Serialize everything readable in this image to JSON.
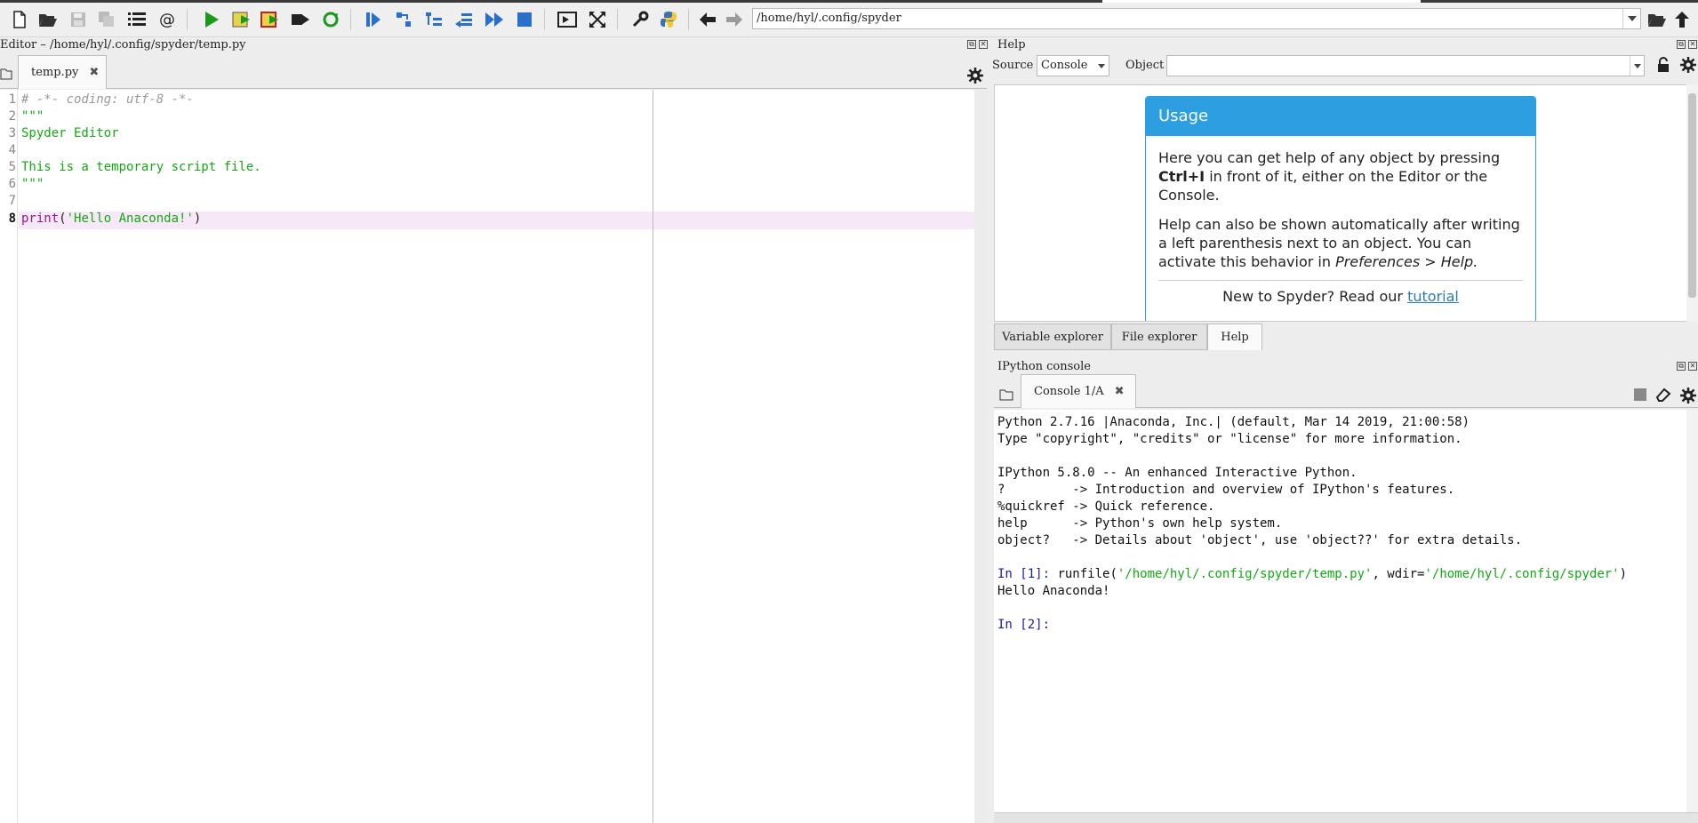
{
  "toolbar": {
    "path": "/home/hyl/.config/spyder",
    "icons": [
      "new-file",
      "open-file",
      "save-file",
      "save-all",
      "outline",
      "at-sign",
      "run",
      "run-cell",
      "run-cell-advance",
      "run-selection",
      "rerun",
      "debug",
      "step",
      "step-into",
      "step-return",
      "continue",
      "stop",
      "maximize-pane",
      "fullscreen",
      "preferences",
      "python-path",
      "back",
      "forward",
      "browse",
      "parent-dir"
    ]
  },
  "editor": {
    "title": "Editor – /home/hyl/.config/spyder/temp.py",
    "tab": "temp.py",
    "lines": [
      {
        "n": "1",
        "text": "# -*- coding: utf-8 -*-",
        "kind": "comment"
      },
      {
        "n": "2",
        "text": "\"\"\"",
        "kind": "string"
      },
      {
        "n": "3",
        "text": "Spyder Editor",
        "kind": "string"
      },
      {
        "n": "4",
        "text": "",
        "kind": "string"
      },
      {
        "n": "5",
        "text": "This is a temporary script file.",
        "kind": "string"
      },
      {
        "n": "6",
        "text": "\"\"\"",
        "kind": "string"
      },
      {
        "n": "7",
        "text": "",
        "kind": "plain"
      },
      {
        "n": "8",
        "parts": {
          "kw": "print",
          "open": "(",
          "str": "'Hello Anaconda!'",
          "close": ")"
        },
        "kind": "code"
      }
    ]
  },
  "help": {
    "title": "Help",
    "source_label": "Source",
    "source_value": "Console",
    "object_label": "Object",
    "object_value": "",
    "usage_title": "Usage",
    "usage_p1_a": "Here you can get help of any object by pressing ",
    "usage_p1_bold": "Ctrl+I",
    "usage_p1_b": " in front of it, either on the Editor or the Console.",
    "usage_p2_a": "Help can also be shown automatically after writing a left parenthesis next to an object. You can activate this behavior in ",
    "usage_p2_italic": "Preferences > Help.",
    "usage_new": "New to Spyder? Read our ",
    "usage_link": "tutorial"
  },
  "dock_tabs": [
    "Variable explorer",
    "File explorer",
    "Help"
  ],
  "console": {
    "title": "IPython console",
    "tab": "Console 1/A",
    "lines": [
      "Python 2.7.16 |Anaconda, Inc.| (default, Mar 14 2019, 21:00:58)",
      "Type \"copyright\", \"credits\" or \"license\" for more information.",
      "IPython 5.8.0 -- An enhanced Interactive Python.",
      "?         -> Introduction and overview of IPython's features.",
      "%quickref -> Quick reference.",
      "help      -> Python's own help system.",
      "object?   -> Details about 'object', use 'object??' for extra details."
    ],
    "in1_prompt": "In [1]: ",
    "in1_fn": "runfile(",
    "in1_arg1": "'/home/hyl/.config/spyder/temp.py'",
    "in1_mid": ", wdir=",
    "in1_arg2": "'/home/hyl/.config/spyder'",
    "in1_close": ")",
    "output": "Hello Anaconda!",
    "in2_prompt": "In [2]: "
  }
}
